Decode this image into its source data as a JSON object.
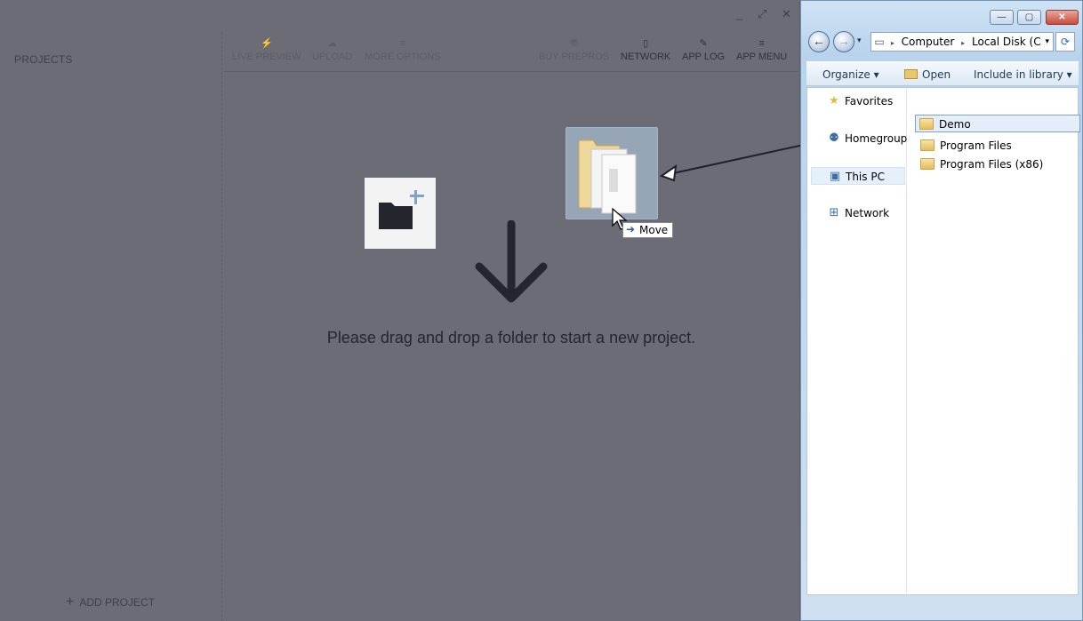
{
  "app": {
    "sidebar_title": "PROJECTS",
    "add_project_label": "ADD PROJECT",
    "toolbar": {
      "live_preview": "LIVE PREVIEW",
      "upload": "UPLOAD",
      "more_options": "MORE OPTIONS",
      "buy_prepros": "BUY PREPROS",
      "network": "NETWORK",
      "app_log": "APP LOG",
      "app_menu": "APP MENU"
    },
    "window_controls": {
      "minimize": "_",
      "maximize": "⤢",
      "close": "✕"
    },
    "drop_message": "Please drag and drop a folder to start a new project.",
    "drag_tooltip": "Move"
  },
  "explorer": {
    "caption": {
      "minimize": "—",
      "maximize": "▢",
      "close": "✕"
    },
    "address": {
      "icon": "computer-icon",
      "segment1": "Computer",
      "segment2": "Local Disk (C"
    },
    "commands": {
      "organize": "Organize ▾",
      "open": "Open",
      "include": "Include in library ▾"
    },
    "nav": [
      {
        "label": "Favorites",
        "icon": "star-icon"
      },
      {
        "label": "Homegroup",
        "icon": "homegroup-icon"
      },
      {
        "label": "This PC",
        "icon": "computer-icon"
      },
      {
        "label": "Network",
        "icon": "network-icon"
      }
    ],
    "files": [
      {
        "name": "Demo",
        "selected": true
      },
      {
        "name": "Program Files",
        "selected": false
      },
      {
        "name": "Program Files (x86)",
        "selected": false
      }
    ]
  },
  "colors": {
    "app_bg": "#6b6c76",
    "explorer_frame": "#b9d3ec",
    "accent": "#7da2ce"
  }
}
